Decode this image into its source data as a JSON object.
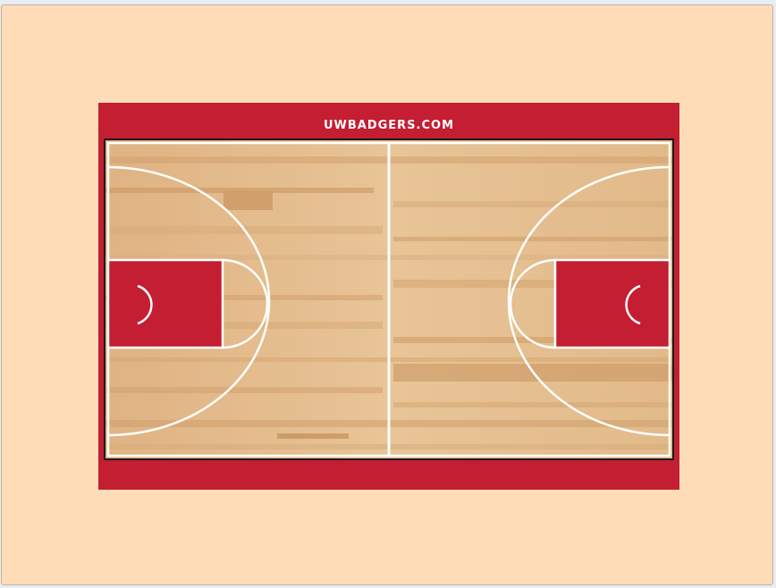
{
  "court": {
    "banner_text": "UWBADGERS.COM"
  },
  "colors": {
    "page_background": "#ffdcb8",
    "apron_red": "#c41e32",
    "paint_red": "#c41e32",
    "wood_base": "#e3b987",
    "line_white": "#ffffff"
  }
}
